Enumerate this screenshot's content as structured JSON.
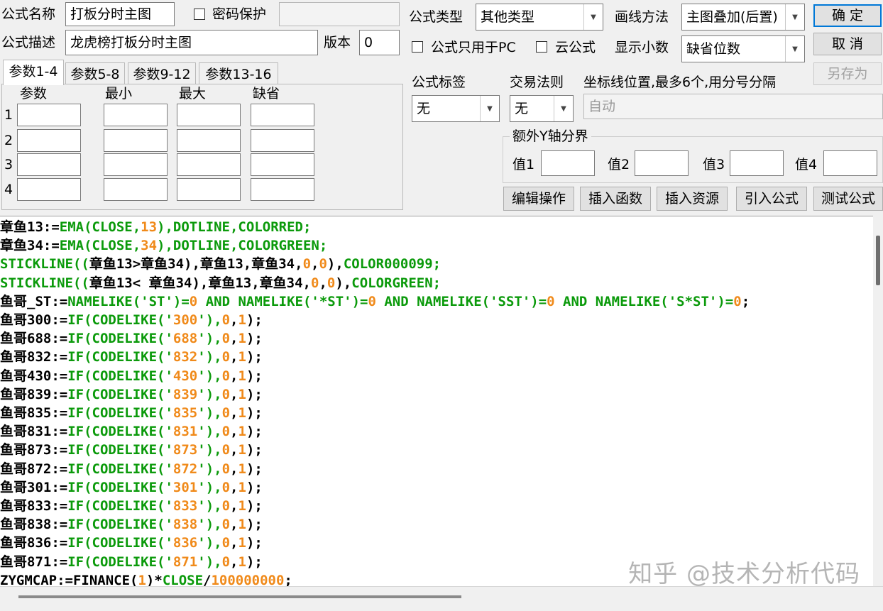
{
  "form": {
    "name_label": "公式名称",
    "name_value": "打板分时主图",
    "password_label": "密码保护",
    "password_value": "",
    "desc_label": "公式描述",
    "desc_value": "龙虎榜打板分时主图",
    "version_label": "版本",
    "version_value": "0",
    "type_label": "公式类型",
    "type_value": "其他类型",
    "draw_label": "画线方法",
    "draw_value": "主图叠加(后置)",
    "pc_only_label": "公式只用于PC",
    "cloud_label": "云公式",
    "decimals_label": "显示小数",
    "decimals_value": "缺省位数"
  },
  "buttons": {
    "ok": "确 定",
    "cancel": "取 消",
    "save_as": "另存为",
    "edit": "编辑操作",
    "insert_func": "插入函数",
    "insert_res": "插入资源",
    "import": "引入公式",
    "test": "测试公式"
  },
  "tabs": [
    "参数1-4",
    "参数5-8",
    "参数9-12",
    "参数13-16"
  ],
  "params": {
    "headers": [
      "参数",
      "最小",
      "最大",
      "缺省"
    ],
    "rows": [
      "1",
      "2",
      "3",
      "4"
    ]
  },
  "tag": {
    "label": "公式标签",
    "value": "无"
  },
  "trade": {
    "label": "交易法则",
    "value": "无"
  },
  "axis": {
    "label": "坐标线位置,最多6个,用分号分隔",
    "placeholder": "自动"
  },
  "yaxis": {
    "title": "额外Y轴分界",
    "labels": [
      "值1",
      "值2",
      "值3",
      "值4"
    ]
  },
  "code_lines": [
    [
      [
        "b",
        "章鱼13:="
      ],
      [
        "g",
        "EMA(CLOSE,"
      ],
      [
        "o",
        "13"
      ],
      [
        "g",
        "),DOTLINE,COLORRED;"
      ]
    ],
    [
      [
        "b",
        "章鱼34:="
      ],
      [
        "g",
        "EMA(CLOSE,"
      ],
      [
        "o",
        "34"
      ],
      [
        "g",
        "),DOTLINE,COLORGREEN;"
      ]
    ],
    [
      [
        "g",
        "STICKLINE(("
      ],
      [
        "b",
        "章鱼13>章鱼34),章鱼13,章鱼34,"
      ],
      [
        "o",
        "0"
      ],
      [
        "b",
        ","
      ],
      [
        "o",
        "0"
      ],
      [
        "b",
        "),"
      ],
      [
        "g",
        "COLOR000099;"
      ]
    ],
    [
      [
        "g",
        "STICKLINE(("
      ],
      [
        "b",
        "章鱼13< 章鱼34),章鱼13,章鱼34,"
      ],
      [
        "o",
        "0"
      ],
      [
        "b",
        ","
      ],
      [
        "o",
        "0"
      ],
      [
        "b",
        "),"
      ],
      [
        "g",
        "COLORGREEN;"
      ]
    ],
    [
      [
        "b",
        "鱼哥_ST:="
      ],
      [
        "g",
        "NAMELIKE('ST')="
      ],
      [
        "o",
        "0"
      ],
      [
        "g",
        " AND NAMELIKE('*ST')="
      ],
      [
        "o",
        "0"
      ],
      [
        "g",
        " AND NAMELIKE('SST')="
      ],
      [
        "o",
        "0"
      ],
      [
        "g",
        " AND NAMELIKE('S*ST')="
      ],
      [
        "o",
        "0"
      ],
      [
        "b",
        ";"
      ]
    ],
    [
      [
        "b",
        "鱼哥300:="
      ],
      [
        "g",
        "IF(CODELIKE('"
      ],
      [
        "o",
        "300"
      ],
      [
        "g",
        "'),"
      ],
      [
        "o",
        "0"
      ],
      [
        "b",
        ","
      ],
      [
        "o",
        "1"
      ],
      [
        "b",
        ");"
      ]
    ],
    [
      [
        "b",
        "鱼哥688:="
      ],
      [
        "g",
        "IF(CODELIKE('"
      ],
      [
        "o",
        "688"
      ],
      [
        "g",
        "'),"
      ],
      [
        "o",
        "0"
      ],
      [
        "b",
        ","
      ],
      [
        "o",
        "1"
      ],
      [
        "b",
        ");"
      ]
    ],
    [
      [
        "b",
        "鱼哥832:="
      ],
      [
        "g",
        "IF(CODELIKE('"
      ],
      [
        "o",
        "832"
      ],
      [
        "g",
        "'),"
      ],
      [
        "o",
        "0"
      ],
      [
        "b",
        ","
      ],
      [
        "o",
        "1"
      ],
      [
        "b",
        ");"
      ]
    ],
    [
      [
        "b",
        "鱼哥430:="
      ],
      [
        "g",
        "IF(CODELIKE('"
      ],
      [
        "o",
        "430"
      ],
      [
        "g",
        "'),"
      ],
      [
        "o",
        "0"
      ],
      [
        "b",
        ","
      ],
      [
        "o",
        "1"
      ],
      [
        "b",
        ");"
      ]
    ],
    [
      [
        "b",
        "鱼哥839:="
      ],
      [
        "g",
        "IF(CODELIKE('"
      ],
      [
        "o",
        "839"
      ],
      [
        "g",
        "'),"
      ],
      [
        "o",
        "0"
      ],
      [
        "b",
        ","
      ],
      [
        "o",
        "1"
      ],
      [
        "b",
        ");"
      ]
    ],
    [
      [
        "b",
        "鱼哥835:="
      ],
      [
        "g",
        "IF(CODELIKE('"
      ],
      [
        "o",
        "835"
      ],
      [
        "g",
        "'),"
      ],
      [
        "o",
        "0"
      ],
      [
        "b",
        ","
      ],
      [
        "o",
        "1"
      ],
      [
        "b",
        ");"
      ]
    ],
    [
      [
        "b",
        "鱼哥831:="
      ],
      [
        "g",
        "IF(CODELIKE('"
      ],
      [
        "o",
        "831"
      ],
      [
        "g",
        "'),"
      ],
      [
        "o",
        "0"
      ],
      [
        "b",
        ","
      ],
      [
        "o",
        "1"
      ],
      [
        "b",
        ");"
      ]
    ],
    [
      [
        "b",
        "鱼哥873:="
      ],
      [
        "g",
        "IF(CODELIKE('"
      ],
      [
        "o",
        "873"
      ],
      [
        "g",
        "'),"
      ],
      [
        "o",
        "0"
      ],
      [
        "b",
        ","
      ],
      [
        "o",
        "1"
      ],
      [
        "b",
        ");"
      ]
    ],
    [
      [
        "b",
        "鱼哥872:="
      ],
      [
        "g",
        "IF(CODELIKE('"
      ],
      [
        "o",
        "872"
      ],
      [
        "g",
        "'),"
      ],
      [
        "o",
        "0"
      ],
      [
        "b",
        ","
      ],
      [
        "o",
        "1"
      ],
      [
        "b",
        ");"
      ]
    ],
    [
      [
        "b",
        "鱼哥301:="
      ],
      [
        "g",
        "IF(CODELIKE('"
      ],
      [
        "o",
        "301"
      ],
      [
        "g",
        "'),"
      ],
      [
        "o",
        "0"
      ],
      [
        "b",
        ","
      ],
      [
        "o",
        "1"
      ],
      [
        "b",
        ");"
      ]
    ],
    [
      [
        "b",
        "鱼哥833:="
      ],
      [
        "g",
        "IF(CODELIKE('"
      ],
      [
        "o",
        "833"
      ],
      [
        "g",
        "'),"
      ],
      [
        "o",
        "0"
      ],
      [
        "b",
        ","
      ],
      [
        "o",
        "1"
      ],
      [
        "b",
        ");"
      ]
    ],
    [
      [
        "b",
        "鱼哥838:="
      ],
      [
        "g",
        "IF(CODELIKE('"
      ],
      [
        "o",
        "838"
      ],
      [
        "g",
        "'),"
      ],
      [
        "o",
        "0"
      ],
      [
        "b",
        ","
      ],
      [
        "o",
        "1"
      ],
      [
        "b",
        ");"
      ]
    ],
    [
      [
        "b",
        "鱼哥836:="
      ],
      [
        "g",
        "IF(CODELIKE('"
      ],
      [
        "o",
        "836"
      ],
      [
        "g",
        "'),"
      ],
      [
        "o",
        "0"
      ],
      [
        "b",
        ","
      ],
      [
        "o",
        "1"
      ],
      [
        "b",
        ");"
      ]
    ],
    [
      [
        "b",
        "鱼哥871:="
      ],
      [
        "g",
        "IF(CODELIKE('"
      ],
      [
        "o",
        "871"
      ],
      [
        "g",
        "'),"
      ],
      [
        "o",
        "0"
      ],
      [
        "b",
        ","
      ],
      [
        "o",
        "1"
      ],
      [
        "b",
        ");"
      ]
    ],
    [
      [
        "b",
        "ZYGMCAP:=FINANCE("
      ],
      [
        "o",
        "1"
      ],
      [
        "b",
        ")*"
      ],
      [
        "g",
        "CLOSE"
      ],
      [
        "b",
        "/"
      ],
      [
        "o",
        "100000000"
      ],
      [
        "b",
        ";"
      ]
    ]
  ],
  "watermark": "知乎 @技术分析代码",
  "colors": {
    "green": "#0b9a0b",
    "orange": "#f08a1a",
    "accent": "#0078d7"
  }
}
